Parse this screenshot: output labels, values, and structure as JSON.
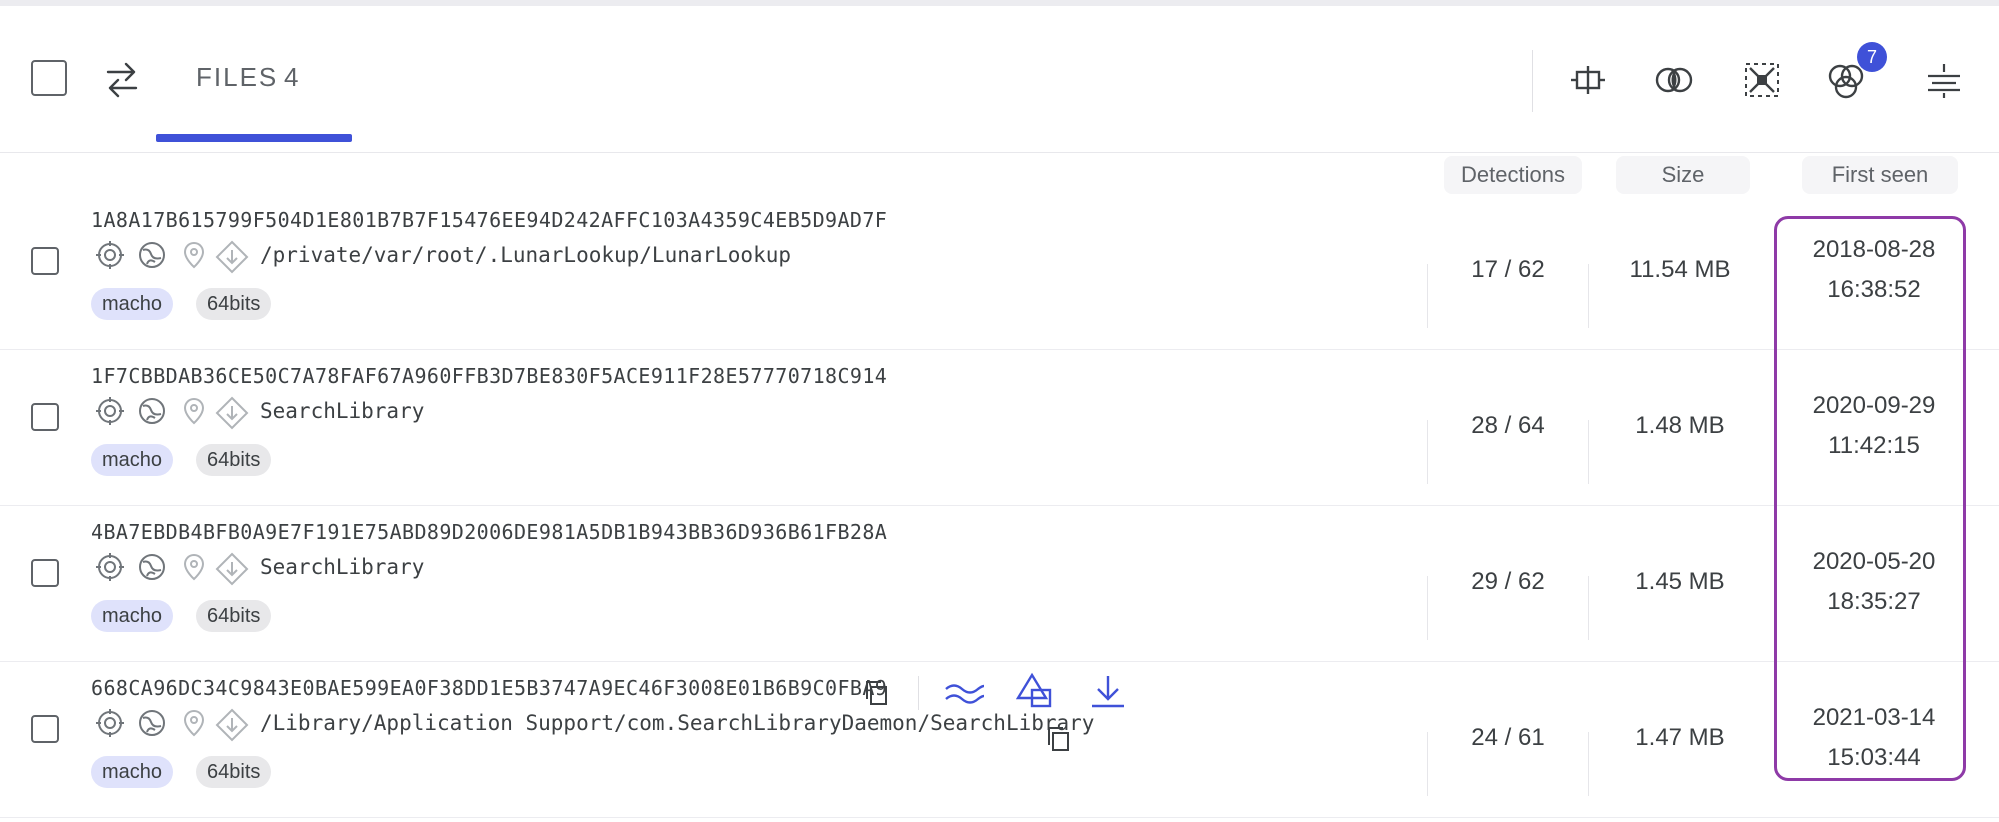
{
  "header": {
    "tab_label": "FILES",
    "tab_count": "4",
    "notification_count": "7",
    "toolbar_icons": [
      "align-center-icon",
      "intersect-circles-icon",
      "cluster-nodes-icon",
      "venn-three-circles-icon",
      "filter-lines-icon"
    ]
  },
  "columns": {
    "detections": "Detections",
    "size": "Size",
    "first_seen": "First seen"
  },
  "rows": [
    {
      "hash": "1A8A17B615799F504D1E801B7B7F15476EE94D242AFFC103A4359C4EB5D9AD7F",
      "path": "/private/var/root/.LunarLookup/LunarLookup",
      "tags": [
        "macho",
        "64bits"
      ],
      "detections": "17 / 62",
      "size": "11.54 MB",
      "first_seen_date": "2018-08-28",
      "first_seen_time": "16:38:52"
    },
    {
      "hash": "1F7CBBDAB36CE50C7A78FAF67A960FFB3D7BE830F5ACE911F28E57770718C914",
      "path": "SearchLibrary",
      "tags": [
        "macho",
        "64bits"
      ],
      "detections": "28 / 64",
      "size": "1.48 MB",
      "first_seen_date": "2020-09-29",
      "first_seen_time": "11:42:15"
    },
    {
      "hash": "4BA7EBDB4BFB0A9E7F191E75ABD89D2006DE981A5DB1B943BB36D936B61FB28A",
      "path": "SearchLibrary",
      "tags": [
        "macho",
        "64bits"
      ],
      "detections": "29 / 62",
      "size": "1.45 MB",
      "first_seen_date": "2020-05-20",
      "first_seen_time": "18:35:27"
    },
    {
      "hash": "668CA96DC34C9843E0BAE599EA0F38DD1E5B3747A9EC46F3008E01B6B9C0FBA9",
      "path": "/Library/Application Support/com.SearchLibraryDaemon/SearchLibrary",
      "tags": [
        "macho",
        "64bits"
      ],
      "detections": "24 / 61",
      "size": "1.47 MB",
      "first_seen_date": "2021-03-14",
      "first_seen_time": "15:03:44"
    }
  ],
  "colors": {
    "accent": "#3f51d8",
    "highlight": "#8e3aa7",
    "macho_tag": "#dfe2fb",
    "bits_tag": "#e8e8ea"
  }
}
